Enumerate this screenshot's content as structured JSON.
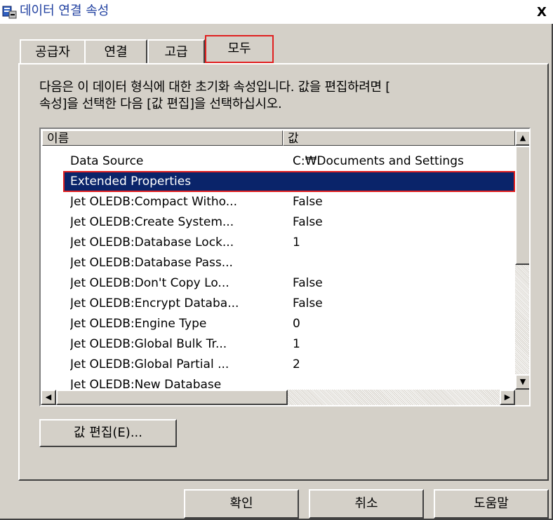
{
  "window": {
    "title": "데이터 연결 속성",
    "close_label": "X"
  },
  "tabs": [
    {
      "label": "공급자"
    },
    {
      "label": "연결"
    },
    {
      "label": "고급"
    },
    {
      "label": "모두",
      "active": true
    }
  ],
  "description": {
    "line1": "다음은 이 데이터 형식에 대한 초기화 속성입니다. 값을 편집하려면 [",
    "line2": "속성]을 선택한 다음 [값 편집]을 선택하십시오."
  },
  "list": {
    "columns": {
      "name": "이름",
      "value": "값"
    },
    "rows": [
      {
        "name": "Data Source",
        "value": "C:₩Documents and Settings"
      },
      {
        "name": "Extended Properties",
        "value": "",
        "selected": true
      },
      {
        "name": "Jet OLEDB:Compact Witho...",
        "value": "False"
      },
      {
        "name": "Jet OLEDB:Create System...",
        "value": "False"
      },
      {
        "name": "Jet OLEDB:Database Lock...",
        "value": "1"
      },
      {
        "name": "Jet OLEDB:Database Pass...",
        "value": ""
      },
      {
        "name": "Jet OLEDB:Don't Copy Lo...",
        "value": "False"
      },
      {
        "name": "Jet OLEDB:Encrypt Databa...",
        "value": "False"
      },
      {
        "name": "Jet OLEDB:Engine Type",
        "value": "0"
      },
      {
        "name": "Jet OLEDB:Global Bulk Tr...",
        "value": "1"
      },
      {
        "name": "Jet OLEDB:Global Partial ...",
        "value": "2"
      },
      {
        "name": "Jet OLEDB:New Database",
        "value": ""
      }
    ]
  },
  "buttons": {
    "edit_value": "값 편집(E)...",
    "ok": "확인",
    "cancel": "취소",
    "help": "도움말"
  },
  "colors": {
    "selection": "#0a246a",
    "highlight_box": "#e02020",
    "face": "#d4d0c8"
  }
}
